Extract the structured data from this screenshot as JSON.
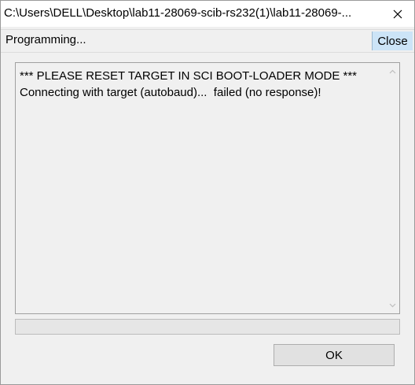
{
  "window": {
    "title": "C:\\Users\\DELL\\Desktop\\lab11-28069-scib-rs232(1)\\lab11-28069-..."
  },
  "header": {
    "status": "Programming...",
    "close_label": "Close"
  },
  "log": {
    "lines": [
      "*** PLEASE RESET TARGET IN SCI BOOT-LOADER MODE ***",
      "Connecting with target (autobaud)...  failed (no response)!"
    ]
  },
  "progress": {
    "value": 0
  },
  "footer": {
    "ok_label": "OK"
  },
  "icons": {
    "window_close": "close-icon",
    "scroll_up": "chevron-up-icon",
    "scroll_down": "chevron-down-icon"
  },
  "colors": {
    "accent": "#cce4f7",
    "progress_fill": "#06b025"
  }
}
